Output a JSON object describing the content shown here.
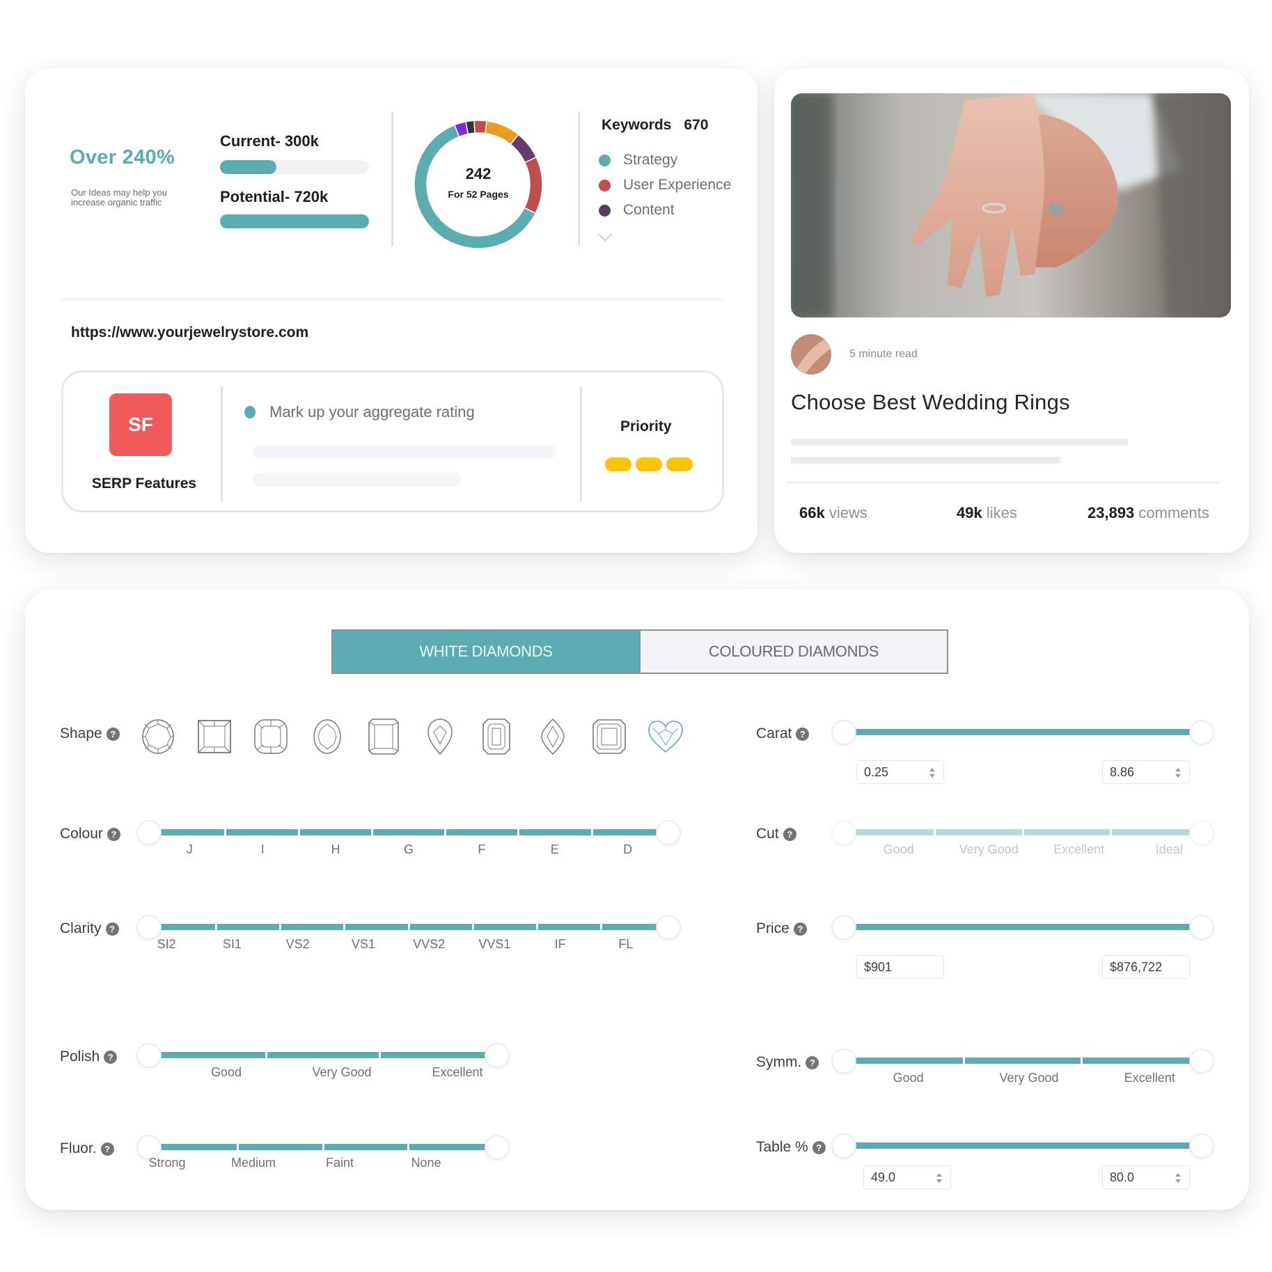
{
  "seo": {
    "growth_title": "Over 240%",
    "growth_subtitle": "Our Ideas may help you increase organic traffic",
    "current_label": "Current- 300k",
    "current_progress": 0.38,
    "potential_label": "Potential- 720k",
    "potential_progress": 1.0,
    "donut": {
      "total": "242",
      "subtitle": "For 52 Pages",
      "segments": [
        {
          "name": "Strategy",
          "value": 64,
          "color": "#5aacb0"
        },
        {
          "name": "Purple",
          "value": 3,
          "color": "#7a2bd8"
        },
        {
          "name": "Dark",
          "value": 2.2,
          "color": "#333336"
        },
        {
          "name": "Red small",
          "value": 3.3,
          "color": "#c04c4c"
        },
        {
          "name": "Orange",
          "value": 9,
          "color": "#e99b22"
        },
        {
          "name": "Content",
          "value": 7.5,
          "color": "#673b6d"
        },
        {
          "name": "User Experience",
          "value": 15,
          "color": "#c04c4c"
        }
      ]
    },
    "keywords_label": "Keywords",
    "keywords_count": "670",
    "legend": [
      {
        "label": "Strategy",
        "color": "#5aacb0"
      },
      {
        "label": "User Experience",
        "color": "#c04c4c"
      },
      {
        "label": "Content",
        "color": "#5b3a63"
      }
    ],
    "site_url": "https://www.yourjewelrystore.com",
    "serp": {
      "badge": "SF",
      "badge_color": "#f05a5b",
      "label": "SERP Features",
      "task": "Mark up your aggregate rating",
      "priority_label": "Priority",
      "priority_level": 3,
      "priority_color": "#fcc30b"
    }
  },
  "blog": {
    "read_time": "5 minute read",
    "title": "Choose Best Wedding Rings",
    "stats": [
      {
        "value": "66k",
        "unit": "views"
      },
      {
        "value": "49k",
        "unit": "likes"
      },
      {
        "value": "23,893",
        "unit": "comments"
      }
    ]
  },
  "filters": {
    "tabs": [
      {
        "label": "WHITE DIAMONDS",
        "active": true
      },
      {
        "label": "COLOURED DIAMONDS",
        "active": false
      }
    ],
    "accent_color": "#5aacb0",
    "shape": {
      "label": "Shape",
      "options": [
        "round",
        "princess",
        "cushion",
        "oval",
        "radiant",
        "pear",
        "emerald",
        "marquise",
        "asscher",
        "heart"
      ],
      "selected": "heart"
    },
    "colour": {
      "label": "Colour",
      "ticks": [
        "J",
        "I",
        "H",
        "G",
        "F",
        "E",
        "D"
      ]
    },
    "clarity": {
      "label": "Clarity",
      "ticks": [
        "SI2",
        "SI1",
        "VS2",
        "VS1",
        "VVS2",
        "VVS1",
        "IF",
        "FL"
      ]
    },
    "polish": {
      "label": "Polish",
      "ticks": [
        "Good",
        "Very Good",
        "Excellent"
      ]
    },
    "fluor": {
      "label": "Fluor.",
      "ticks": [
        "Strong",
        "Medium",
        "Faint",
        "None"
      ]
    },
    "carat": {
      "label": "Carat",
      "min": "0.25",
      "max": "8.86"
    },
    "cut": {
      "label": "Cut",
      "ticks": [
        "Good",
        "Very Good",
        "Excellent",
        "Ideal"
      ],
      "disabled": true
    },
    "price": {
      "label": "Price",
      "min": "$901",
      "max": "$876,722"
    },
    "symm": {
      "label": "Symm.",
      "ticks": [
        "Good",
        "Very Good",
        "Excellent"
      ]
    },
    "table": {
      "label": "Table %",
      "min": "49.0",
      "max": "80.0"
    },
    "help_glyph": "?"
  }
}
